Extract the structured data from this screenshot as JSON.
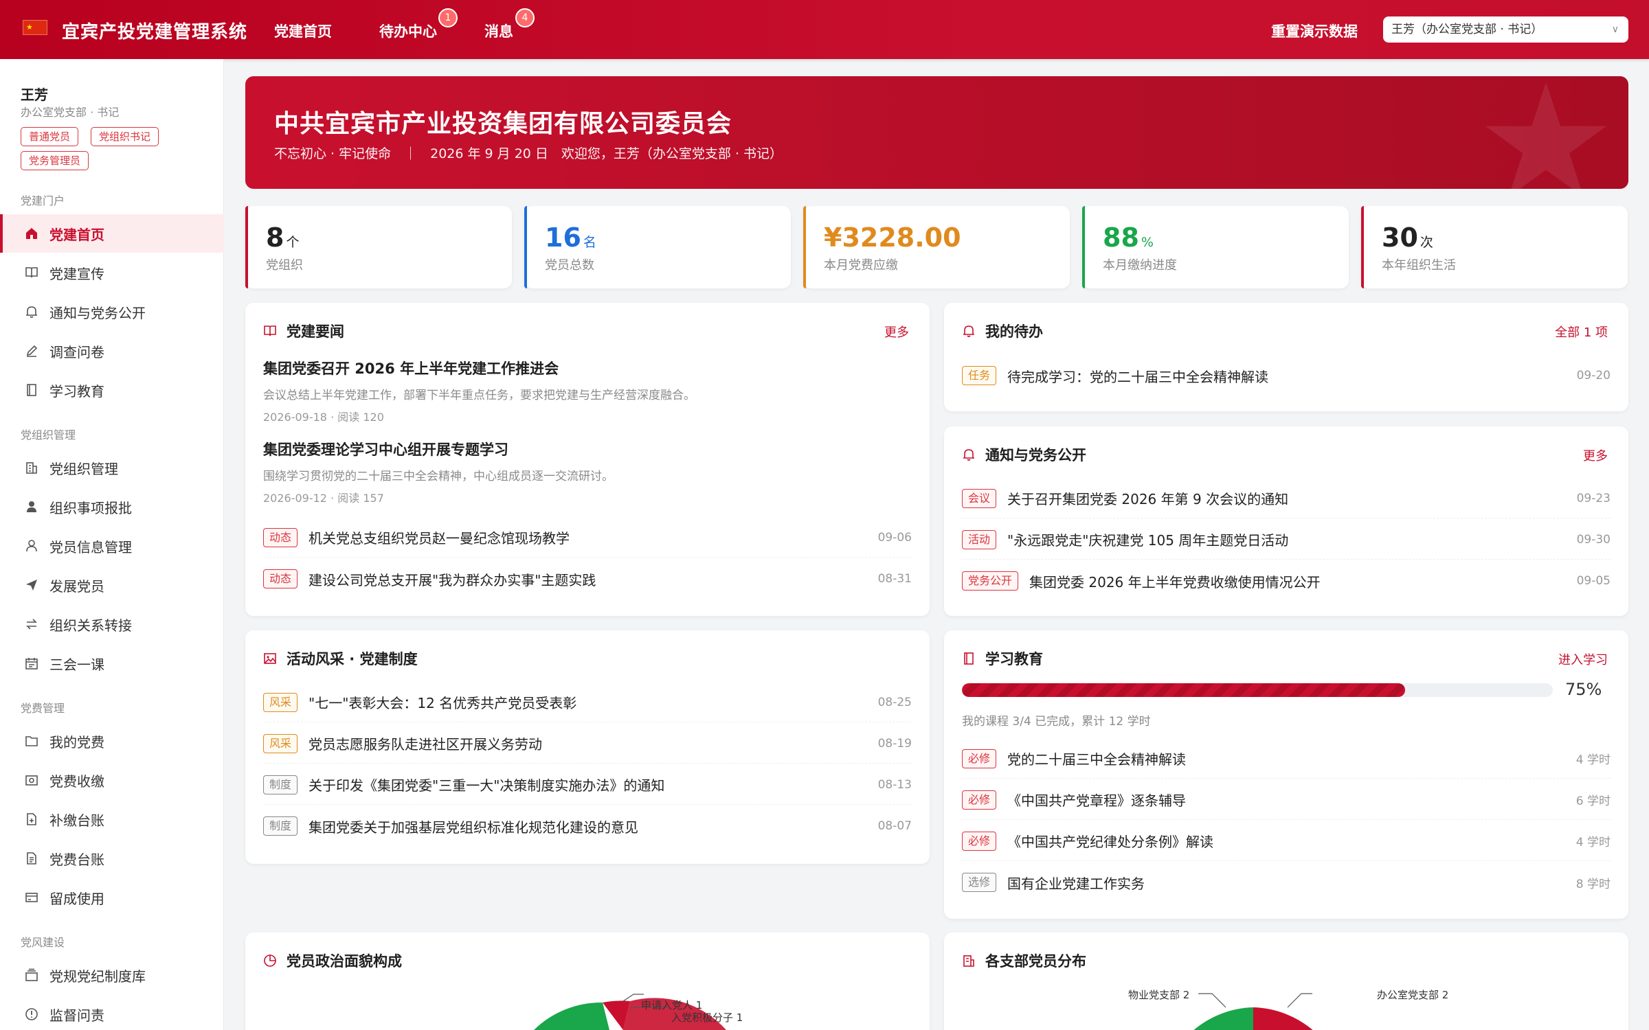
{
  "topbar": {
    "brand": "宜宾产投党建管理系统",
    "nav": [
      {
        "label": "党建首页",
        "badge": ""
      },
      {
        "label": "待办中心",
        "badge": "1"
      },
      {
        "label": "消息",
        "badge": "4"
      }
    ],
    "reset_label": "重置演示数据",
    "user_select": "王芳（办公室党支部 · 书记）"
  },
  "user": {
    "name": "王芳",
    "role": "办公室党支部 · 书记",
    "tags": [
      "普通党员",
      "党组织书记",
      "党务管理员"
    ]
  },
  "sidebar": {
    "sections": [
      {
        "title": "党建门户",
        "items": [
          "党建首页",
          "党建宣传",
          "通知与党务公开",
          "调查问卷",
          "学习教育"
        ]
      },
      {
        "title": "党组织管理",
        "items": [
          "党组织管理",
          "组织事项报批",
          "党员信息管理",
          "发展党员",
          "组织关系转接",
          "三会一课"
        ]
      },
      {
        "title": "党费管理",
        "items": [
          "我的党费",
          "党费收缴",
          "补缴台账",
          "党费台账",
          "留成使用"
        ]
      },
      {
        "title": "党风建设",
        "items": [
          "党规党纪制度库",
          "监督问责"
        ]
      }
    ]
  },
  "hero": {
    "title": "中共宜宾市产业投资集团有限公司委员会",
    "subtitle": "不忘初心 · 牢记使命　｜　2026 年 9 月 20 日　欢迎您，王芳（办公室党支部 · 书记）"
  },
  "stats": [
    {
      "value": "8",
      "unit": "个",
      "label": "党组织",
      "color": "#c8102e"
    },
    {
      "value": "16",
      "unit": "名",
      "label": "党员总数",
      "color": "#1e6fd9"
    },
    {
      "value": "¥3228.00",
      "unit": "",
      "label": "本月党费应缴",
      "color": "#e08a1e"
    },
    {
      "value": "88",
      "unit": "%",
      "label": "本月缴纳进度",
      "color": "#1aa64a"
    },
    {
      "value": "30",
      "unit": "次",
      "label": "本年组织生活",
      "color": "#c8102e"
    }
  ],
  "news": {
    "title": "党建要闻",
    "more": "更多",
    "featured": [
      {
        "title": "集团党委召开 2026 年上半年党建工作推进会",
        "desc": "会议总结上半年党建工作，部署下半年重点任务，要求把党建与生产经营深度融合。",
        "meta": "2026-09-18 · 阅读 120"
      },
      {
        "title": "集团党委理论学习中心组开展专题学习",
        "desc": "围绕学习贯彻党的二十届三中全会精神，中心组成员逐一交流研讨。",
        "meta": "2026-09-12 · 阅读 157"
      }
    ],
    "items": [
      {
        "tag": "动态",
        "text": "机关党总支组织党员赵一曼纪念馆现场教学",
        "date": "09-06"
      },
      {
        "tag": "动态",
        "text": "建设公司党总支开展\"我为群众办实事\"主题实践",
        "date": "08-31"
      }
    ]
  },
  "todo": {
    "title": "我的待办",
    "more": "全部 1 项",
    "items": [
      {
        "tag": "任务",
        "text": "待完成学习：党的二十届三中全会精神解读",
        "date": "09-20"
      }
    ]
  },
  "notices": {
    "title": "通知与党务公开",
    "more": "更多",
    "items": [
      {
        "tag": "会议",
        "text": "关于召开集团党委 2026 年第 9 次会议的通知",
        "date": "09-23"
      },
      {
        "tag": "活动",
        "text": "\"永远跟党走\"庆祝建党 105 周年主题党日活动",
        "date": "09-30"
      },
      {
        "tag": "党务公开",
        "text": "集团党委 2026 年上半年党费收缴使用情况公开",
        "date": "09-05"
      }
    ]
  },
  "activities": {
    "title": "活动风采 · 党建制度",
    "items": [
      {
        "tag": "风采",
        "text": "\"七一\"表彰大会：12 名优秀共产党员受表彰",
        "date": "08-25"
      },
      {
        "tag": "风采",
        "text": "党员志愿服务队走进社区开展义务劳动",
        "date": "08-19"
      },
      {
        "tag": "制度",
        "text": "关于印发《集团党委\"三重一大\"决策制度实施办法》的通知",
        "date": "08-13"
      },
      {
        "tag": "制度",
        "text": "集团党委关于加强基层党组织标准化规范化建设的意见",
        "date": "08-07"
      }
    ]
  },
  "study": {
    "title": "学习教育",
    "more": "进入学习",
    "progress": 75,
    "progress_label": "75%",
    "note": "我的课程 3/4 已完成，累计 12 学时",
    "items": [
      {
        "tag": "必修",
        "text": "党的二十届三中全会精神解读",
        "date": "4 学时"
      },
      {
        "tag": "必修",
        "text": "《中国共产党章程》逐条辅导",
        "date": "6 学时"
      },
      {
        "tag": "必修",
        "text": "《中国共产党纪律处分条例》解读",
        "date": "4 学时"
      },
      {
        "tag": "选修",
        "text": "国有企业党建工作实务",
        "date": "8 学时"
      }
    ]
  },
  "political": {
    "title": "党员政治面貌构成",
    "labels": [
      "申请入党人 1",
      "入党积极分子 1"
    ]
  },
  "branches": {
    "title": "各支部党员分布",
    "labels": [
      "物业党支部 2",
      "办公室党支部 2"
    ]
  }
}
